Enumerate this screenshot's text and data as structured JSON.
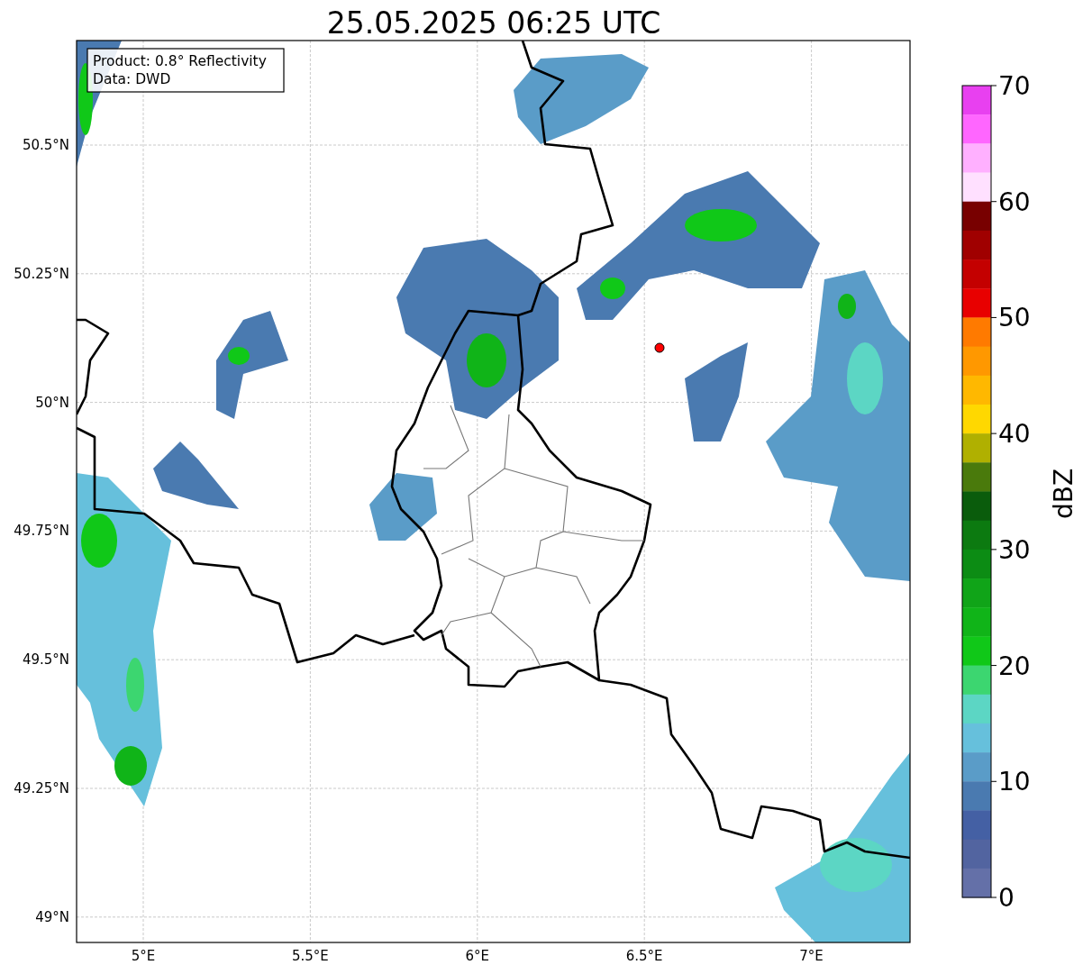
{
  "title": "25.05.2025 06:25 UTC",
  "info_box": [
    "Product: 0.8° Reflectivity",
    "Data: DWD"
  ],
  "map": {
    "x_ticks": [
      "5°E",
      "5.5°E",
      "6°E",
      "6.5°E",
      "7°E"
    ],
    "y_ticks": [
      "50.5°N",
      "50.25°N",
      "50°N",
      "49.75°N",
      "49.5°N",
      "49.25°N",
      "49°N"
    ]
  },
  "colorbar": {
    "label": "dBZ",
    "ticks": [
      "70",
      "60",
      "50",
      "40",
      "30",
      "20",
      "10",
      "0"
    ],
    "segments": [
      {
        "color": "#e840f0"
      },
      {
        "color": "#ff66ff"
      },
      {
        "color": "#ffb0ff"
      },
      {
        "color": "#ffe0ff"
      },
      {
        "color": "#780000"
      },
      {
        "color": "#a00000"
      },
      {
        "color": "#c40000"
      },
      {
        "color": "#e80000"
      },
      {
        "color": "#ff7a00"
      },
      {
        "color": "#ff9800"
      },
      {
        "color": "#ffb800"
      },
      {
        "color": "#ffd800"
      },
      {
        "color": "#b0b000"
      },
      {
        "color": "#4a7a0c"
      },
      {
        "color": "#0a5c0c"
      },
      {
        "color": "#0c7a10"
      },
      {
        "color": "#0c8c14"
      },
      {
        "color": "#10a418"
      },
      {
        "color": "#10b418"
      },
      {
        "color": "#10c818"
      },
      {
        "color": "#3cd670"
      },
      {
        "color": "#5cd6c4"
      },
      {
        "color": "#66c0dc"
      },
      {
        "color": "#5a9cc8"
      },
      {
        "color": "#4a7ab0"
      },
      {
        "color": "#4460a4"
      },
      {
        "color": "#5264a0"
      },
      {
        "color": "#6470a8"
      }
    ]
  }
}
